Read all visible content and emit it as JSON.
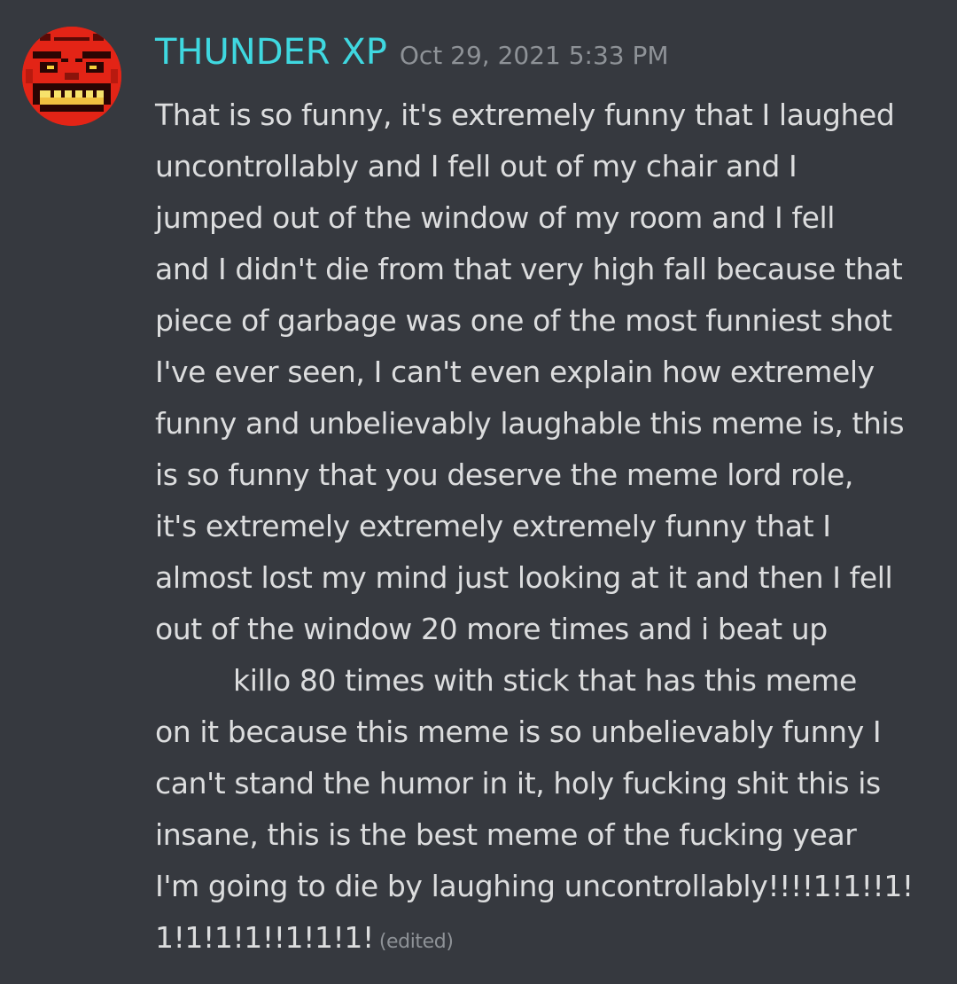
{
  "message": {
    "author": "THUNDER XP",
    "timestamp": "Oct 29, 2021 5:33 PM",
    "avatar_icon": "pixel-red-grinning-face-icon",
    "author_color": "#3fd8e0",
    "lines": [
      "That is so funny, it's extremely funny that I laughed",
      "uncontrollably and I fell out of my chair and I",
      "jumped out of the window of my room and I fell",
      "and I didn't die from that very high fall because that",
      "piece of garbage was one of the most funniest shot",
      "I've ever seen, I can't even explain how extremely",
      "funny and unbelievably laughable this meme is, this",
      "is so funny that you deserve the meme lord role,",
      "it's extremely extremely extremely funny that I",
      "almost lost my mind just looking at it and then I fell",
      "out of the window 20 more times and i beat up",
      "killo 80 times with stick that has this meme",
      "on it because this meme is so unbelievably funny I",
      "can't stand the humor in it, holy fucking shit this is",
      "insane, this is the best meme of the fucking year",
      "I'm going to die by laughing uncontrollably!!!!1!1!!1!",
      "1!1!1!1!!1!1!1!"
    ],
    "edited_label": "(edited)"
  },
  "colors": {
    "background": "#36393f",
    "text": "#dcddde",
    "muted": "#8e9297"
  }
}
